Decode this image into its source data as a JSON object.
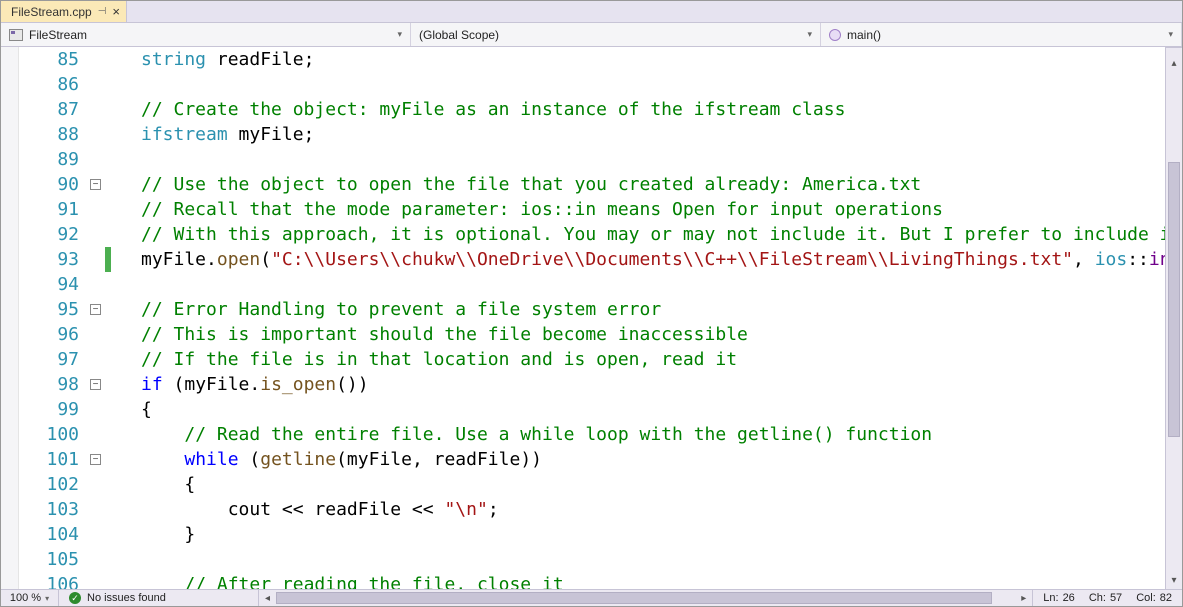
{
  "tab": {
    "filename": "FileStream.cpp",
    "pinned": true
  },
  "nav": {
    "class_name": "FileStream",
    "scope": "(Global Scope)",
    "member": "main()"
  },
  "code": {
    "first_line": 85,
    "lines": [
      {
        "n": 85,
        "tokens": [
          [
            "typ",
            "string"
          ],
          [
            "id",
            " readFile;"
          ]
        ]
      },
      {
        "n": 86,
        "tokens": []
      },
      {
        "n": 87,
        "tokens": [
          [
            "com",
            "// Create the object: myFile as an instance of the ifstream class"
          ]
        ]
      },
      {
        "n": 88,
        "tokens": [
          [
            "typ",
            "ifstream"
          ],
          [
            "id",
            " myFile;"
          ]
        ]
      },
      {
        "n": 89,
        "tokens": []
      },
      {
        "n": 90,
        "outline": "-",
        "tokens": [
          [
            "com",
            "// Use the object to open the file that you created already: America.txt"
          ]
        ]
      },
      {
        "n": 91,
        "tokens": [
          [
            "com",
            "// Recall that the mode parameter: ios::in means Open for input operations"
          ]
        ]
      },
      {
        "n": 92,
        "tokens": [
          [
            "com",
            "// With this approach, it is optional. You may or may not include it. But I prefer to include it"
          ]
        ]
      },
      {
        "n": 93,
        "changed": true,
        "tokens": [
          [
            "id",
            "myFile."
          ],
          [
            "fn",
            "open"
          ],
          [
            "id",
            "("
          ],
          [
            "str",
            "\"C:\\\\Users\\\\chukw\\\\OneDrive\\\\Documents\\\\C++\\\\FileStream\\\\LivingThings.txt\""
          ],
          [
            "id",
            ", "
          ],
          [
            "typ",
            "ios"
          ],
          [
            "id",
            "::"
          ],
          [
            "mem",
            "in"
          ],
          [
            "id",
            ");"
          ]
        ]
      },
      {
        "n": 94,
        "tokens": []
      },
      {
        "n": 95,
        "outline": "-",
        "tokens": [
          [
            "com",
            "// Error Handling to prevent a file system error"
          ]
        ]
      },
      {
        "n": 96,
        "tokens": [
          [
            "com",
            "// This is important should the file become inaccessible"
          ]
        ]
      },
      {
        "n": 97,
        "tokens": [
          [
            "com",
            "// If the file is in that location and is open, read it"
          ]
        ]
      },
      {
        "n": 98,
        "outline": "-",
        "tokens": [
          [
            "kw",
            "if"
          ],
          [
            "id",
            " (myFile."
          ],
          [
            "fn",
            "is_open"
          ],
          [
            "id",
            "())"
          ]
        ]
      },
      {
        "n": 99,
        "tokens": [
          [
            "id",
            "{"
          ]
        ]
      },
      {
        "n": 100,
        "indent": 1,
        "tokens": [
          [
            "com",
            "// Read the entire file. Use a while loop with the getline() function"
          ]
        ]
      },
      {
        "n": 101,
        "outline": "-",
        "indent": 1,
        "tokens": [
          [
            "kw",
            "while"
          ],
          [
            "id",
            " ("
          ],
          [
            "fn",
            "getline"
          ],
          [
            "id",
            "(myFile, readFile))"
          ]
        ]
      },
      {
        "n": 102,
        "indent": 1,
        "tokens": [
          [
            "id",
            "{"
          ]
        ]
      },
      {
        "n": 103,
        "indent": 2,
        "tokens": [
          [
            "id",
            "cout << readFile << "
          ],
          [
            "str",
            "\"\\n\""
          ],
          [
            "id",
            ";"
          ]
        ]
      },
      {
        "n": 104,
        "indent": 1,
        "tokens": [
          [
            "id",
            "}"
          ]
        ]
      },
      {
        "n": 105,
        "tokens": []
      },
      {
        "n": 106,
        "indent": 1,
        "tokens": [
          [
            "com",
            "// After reading the file, close it"
          ]
        ]
      }
    ]
  },
  "status": {
    "zoom": "100 %",
    "issues": "No issues found",
    "line_label": "Ln:",
    "line": "26",
    "char_label": "Ch:",
    "char": "57",
    "col_label": "Col:",
    "col": "82"
  }
}
